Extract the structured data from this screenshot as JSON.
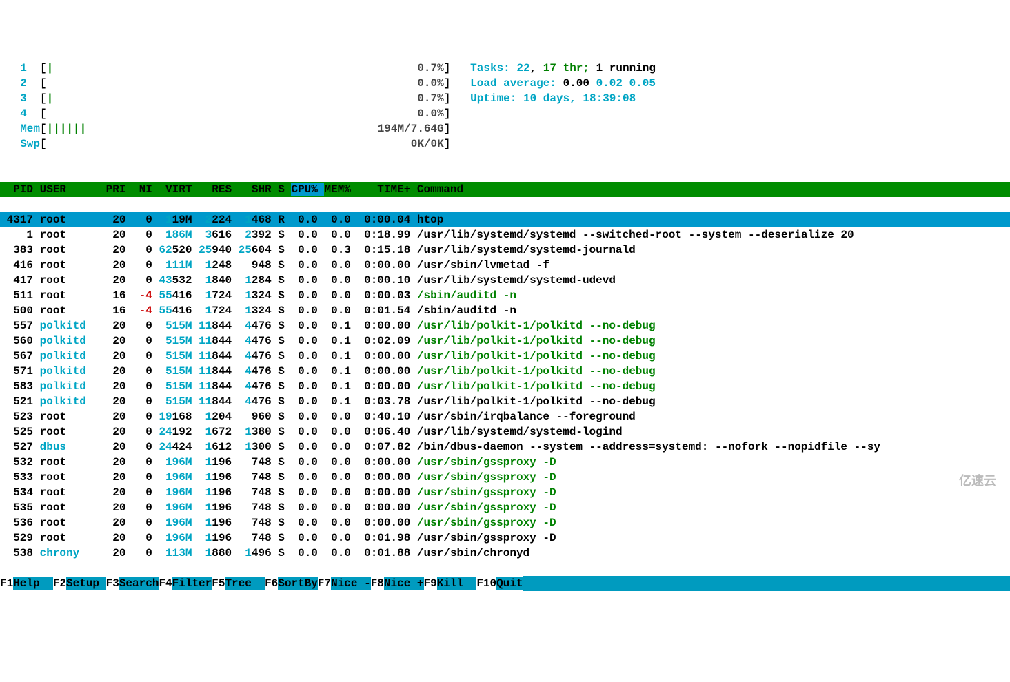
{
  "cpu_meters": [
    {
      "id": "1",
      "bar": "|",
      "pct": "0.7%"
    },
    {
      "id": "2",
      "bar": "",
      "pct": "0.0%"
    },
    {
      "id": "3",
      "bar": "|",
      "pct": "0.7%"
    },
    {
      "id": "4",
      "bar": "",
      "pct": "0.0%"
    }
  ],
  "mem": {
    "label": "Mem",
    "bar": "||||||",
    "value": "194M/7.64G"
  },
  "swp": {
    "label": "Swp",
    "bar": "",
    "value": "0K/0K"
  },
  "tasks": {
    "label": "Tasks: ",
    "total": "22",
    "sep1": ", ",
    "threads": "17",
    "thr_txt": " thr; ",
    "running": "1 running"
  },
  "load": {
    "label": "Load average: ",
    "v1": "0.00",
    "v2": "0.02",
    "v3": "0.05"
  },
  "uptime": {
    "label": "Uptime: ",
    "value": "10 days, 18:39:08"
  },
  "columns": {
    "pid": "PID",
    "user": "USER",
    "pri": "PRI",
    "ni": "NI",
    "virt": "VIRT",
    "res": "RES",
    "shr": "SHR",
    "s": "S",
    "cpu": "CPU%",
    "mem": "MEM%",
    "time": "TIME+",
    "cmd": "Command"
  },
  "processes": [
    {
      "pid": "4317",
      "user": "root",
      "pri": "20",
      "ni": "0",
      "virt": "119M",
      "res": "2224",
      "shr": "1468",
      "s": "R",
      "cpu": "0.0",
      "mem": "0.0",
      "time": "0:00.04",
      "cmd": "htop",
      "green_cmd": false,
      "selected": true,
      "virt_cyan": false,
      "ni_red": false
    },
    {
      "pid": "1",
      "user": "root",
      "pri": "20",
      "ni": "0",
      "virt": "186M",
      "res": "3616",
      "shr": "2392",
      "s": "S",
      "cpu": "0.0",
      "mem": "0.0",
      "time": "0:18.99",
      "cmd": "/usr/lib/systemd/systemd --switched-root --system --deserialize 20",
      "green_cmd": false,
      "virt_cyan": true,
      "ni_red": false
    },
    {
      "pid": "383",
      "user": "root",
      "pri": "20",
      "ni": "0",
      "virt": "62520",
      "res": "25940",
      "shr": "25604",
      "s": "S",
      "cpu": "0.0",
      "mem": "0.3",
      "time": "0:15.18",
      "cmd": "/usr/lib/systemd/systemd-journald",
      "green_cmd": false,
      "virt_cyan": false,
      "ni_red": false
    },
    {
      "pid": "416",
      "user": "root",
      "pri": "20",
      "ni": "0",
      "virt": "111M",
      "res": "1248",
      "shr": "948",
      "s": "S",
      "cpu": "0.0",
      "mem": "0.0",
      "time": "0:00.00",
      "cmd": "/usr/sbin/lvmetad -f",
      "green_cmd": false,
      "virt_cyan": true,
      "ni_red": false
    },
    {
      "pid": "417",
      "user": "root",
      "pri": "20",
      "ni": "0",
      "virt": "43532",
      "res": "1840",
      "shr": "1284",
      "s": "S",
      "cpu": "0.0",
      "mem": "0.0",
      "time": "0:00.10",
      "cmd": "/usr/lib/systemd/systemd-udevd",
      "green_cmd": false,
      "virt_cyan": false,
      "ni_red": false
    },
    {
      "pid": "511",
      "user": "root",
      "pri": "16",
      "ni": "-4",
      "virt": "55416",
      "res": "1724",
      "shr": "1324",
      "s": "S",
      "cpu": "0.0",
      "mem": "0.0",
      "time": "0:00.03",
      "cmd": "/sbin/auditd -n",
      "green_cmd": true,
      "virt_cyan": false,
      "ni_red": true
    },
    {
      "pid": "500",
      "user": "root",
      "pri": "16",
      "ni": "-4",
      "virt": "55416",
      "res": "1724",
      "shr": "1324",
      "s": "S",
      "cpu": "0.0",
      "mem": "0.0",
      "time": "0:01.54",
      "cmd": "/sbin/auditd -n",
      "green_cmd": false,
      "virt_cyan": false,
      "ni_red": true
    },
    {
      "pid": "557",
      "user": "polkitd",
      "pri": "20",
      "ni": "0",
      "virt": "515M",
      "res": "11844",
      "shr": "4476",
      "s": "S",
      "cpu": "0.0",
      "mem": "0.1",
      "time": "0:00.00",
      "cmd": "/usr/lib/polkit-1/polkitd --no-debug",
      "green_cmd": true,
      "virt_cyan": true,
      "ni_red": false
    },
    {
      "pid": "560",
      "user": "polkitd",
      "pri": "20",
      "ni": "0",
      "virt": "515M",
      "res": "11844",
      "shr": "4476",
      "s": "S",
      "cpu": "0.0",
      "mem": "0.1",
      "time": "0:02.09",
      "cmd": "/usr/lib/polkit-1/polkitd --no-debug",
      "green_cmd": true,
      "virt_cyan": true,
      "ni_red": false
    },
    {
      "pid": "567",
      "user": "polkitd",
      "pri": "20",
      "ni": "0",
      "virt": "515M",
      "res": "11844",
      "shr": "4476",
      "s": "S",
      "cpu": "0.0",
      "mem": "0.1",
      "time": "0:00.00",
      "cmd": "/usr/lib/polkit-1/polkitd --no-debug",
      "green_cmd": true,
      "virt_cyan": true,
      "ni_red": false
    },
    {
      "pid": "571",
      "user": "polkitd",
      "pri": "20",
      "ni": "0",
      "virt": "515M",
      "res": "11844",
      "shr": "4476",
      "s": "S",
      "cpu": "0.0",
      "mem": "0.1",
      "time": "0:00.00",
      "cmd": "/usr/lib/polkit-1/polkitd --no-debug",
      "green_cmd": true,
      "virt_cyan": true,
      "ni_red": false
    },
    {
      "pid": "583",
      "user": "polkitd",
      "pri": "20",
      "ni": "0",
      "virt": "515M",
      "res": "11844",
      "shr": "4476",
      "s": "S",
      "cpu": "0.0",
      "mem": "0.1",
      "time": "0:00.00",
      "cmd": "/usr/lib/polkit-1/polkitd --no-debug",
      "green_cmd": true,
      "virt_cyan": true,
      "ni_red": false
    },
    {
      "pid": "521",
      "user": "polkitd",
      "pri": "20",
      "ni": "0",
      "virt": "515M",
      "res": "11844",
      "shr": "4476",
      "s": "S",
      "cpu": "0.0",
      "mem": "0.1",
      "time": "0:03.78",
      "cmd": "/usr/lib/polkit-1/polkitd --no-debug",
      "green_cmd": false,
      "virt_cyan": true,
      "ni_red": false
    },
    {
      "pid": "523",
      "user": "root",
      "pri": "20",
      "ni": "0",
      "virt": "19168",
      "res": "1204",
      "shr": "960",
      "s": "S",
      "cpu": "0.0",
      "mem": "0.0",
      "time": "0:40.10",
      "cmd": "/usr/sbin/irqbalance --foreground",
      "green_cmd": false,
      "virt_cyan": false,
      "ni_red": false
    },
    {
      "pid": "525",
      "user": "root",
      "pri": "20",
      "ni": "0",
      "virt": "24192",
      "res": "1672",
      "shr": "1380",
      "s": "S",
      "cpu": "0.0",
      "mem": "0.0",
      "time": "0:06.40",
      "cmd": "/usr/lib/systemd/systemd-logind",
      "green_cmd": false,
      "virt_cyan": false,
      "ni_red": false
    },
    {
      "pid": "527",
      "user": "dbus",
      "pri": "20",
      "ni": "0",
      "virt": "24424",
      "res": "1612",
      "shr": "1300",
      "s": "S",
      "cpu": "0.0",
      "mem": "0.0",
      "time": "0:07.82",
      "cmd": "/bin/dbus-daemon --system --address=systemd: --nofork --nopidfile --sy",
      "green_cmd": false,
      "virt_cyan": false,
      "ni_red": false
    },
    {
      "pid": "532",
      "user": "root",
      "pri": "20",
      "ni": "0",
      "virt": "196M",
      "res": "1196",
      "shr": "748",
      "s": "S",
      "cpu": "0.0",
      "mem": "0.0",
      "time": "0:00.00",
      "cmd": "/usr/sbin/gssproxy -D",
      "green_cmd": true,
      "virt_cyan": true,
      "ni_red": false
    },
    {
      "pid": "533",
      "user": "root",
      "pri": "20",
      "ni": "0",
      "virt": "196M",
      "res": "1196",
      "shr": "748",
      "s": "S",
      "cpu": "0.0",
      "mem": "0.0",
      "time": "0:00.00",
      "cmd": "/usr/sbin/gssproxy -D",
      "green_cmd": true,
      "virt_cyan": true,
      "ni_red": false
    },
    {
      "pid": "534",
      "user": "root",
      "pri": "20",
      "ni": "0",
      "virt": "196M",
      "res": "1196",
      "shr": "748",
      "s": "S",
      "cpu": "0.0",
      "mem": "0.0",
      "time": "0:00.00",
      "cmd": "/usr/sbin/gssproxy -D",
      "green_cmd": true,
      "virt_cyan": true,
      "ni_red": false
    },
    {
      "pid": "535",
      "user": "root",
      "pri": "20",
      "ni": "0",
      "virt": "196M",
      "res": "1196",
      "shr": "748",
      "s": "S",
      "cpu": "0.0",
      "mem": "0.0",
      "time": "0:00.00",
      "cmd": "/usr/sbin/gssproxy -D",
      "green_cmd": true,
      "virt_cyan": true,
      "ni_red": false
    },
    {
      "pid": "536",
      "user": "root",
      "pri": "20",
      "ni": "0",
      "virt": "196M",
      "res": "1196",
      "shr": "748",
      "s": "S",
      "cpu": "0.0",
      "mem": "0.0",
      "time": "0:00.00",
      "cmd": "/usr/sbin/gssproxy -D",
      "green_cmd": true,
      "virt_cyan": true,
      "ni_red": false
    },
    {
      "pid": "529",
      "user": "root",
      "pri": "20",
      "ni": "0",
      "virt": "196M",
      "res": "1196",
      "shr": "748",
      "s": "S",
      "cpu": "0.0",
      "mem": "0.0",
      "time": "0:01.98",
      "cmd": "/usr/sbin/gssproxy -D",
      "green_cmd": false,
      "virt_cyan": true,
      "ni_red": false
    },
    {
      "pid": "538",
      "user": "chrony",
      "pri": "20",
      "ni": "0",
      "virt": "113M",
      "res": "1880",
      "shr": "1496",
      "s": "S",
      "cpu": "0.0",
      "mem": "0.0",
      "time": "0:01.88",
      "cmd": "/usr/sbin/chronyd",
      "green_cmd": false,
      "virt_cyan": true,
      "ni_red": false
    }
  ],
  "fnkeys": [
    {
      "k": "F1",
      "l": "Help  "
    },
    {
      "k": "F2",
      "l": "Setup "
    },
    {
      "k": "F3",
      "l": "Search"
    },
    {
      "k": "F4",
      "l": "Filter"
    },
    {
      "k": "F5",
      "l": "Tree  "
    },
    {
      "k": "F6",
      "l": "SortBy"
    },
    {
      "k": "F7",
      "l": "Nice -"
    },
    {
      "k": "F8",
      "l": "Nice +"
    },
    {
      "k": "F9",
      "l": "Kill  "
    },
    {
      "k": "F10",
      "l": "Quit"
    }
  ],
  "watermark": "亿速云"
}
